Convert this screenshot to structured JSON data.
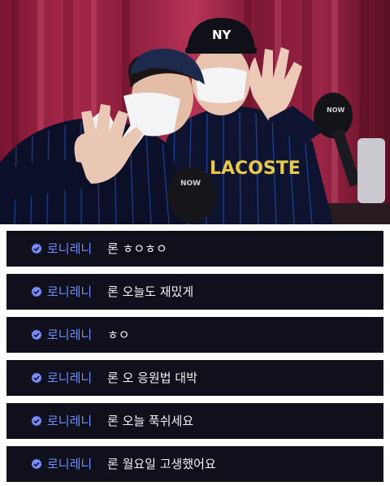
{
  "photo": {
    "logo_text": "NY",
    "sweater_text": "LACOSTE",
    "mic_text": "NOW"
  },
  "chat": {
    "nickname_color": "#6f8dff",
    "badge_color": "#7b8cff",
    "messages": [
      {
        "nickname": "로니레니",
        "text": "론 ㅎㅇㅎㅇ"
      },
      {
        "nickname": "로니레니",
        "text": "론 오늘도 재밌게"
      },
      {
        "nickname": "로니레니",
        "text": "ㅎㅇ"
      },
      {
        "nickname": "로니레니",
        "text": "론 오 응원법 대박"
      },
      {
        "nickname": "로니레니",
        "text": "론 오늘 푹쉬세요"
      },
      {
        "nickname": "로니레니",
        "text": "론 월요일 고생했어요"
      }
    ]
  }
}
